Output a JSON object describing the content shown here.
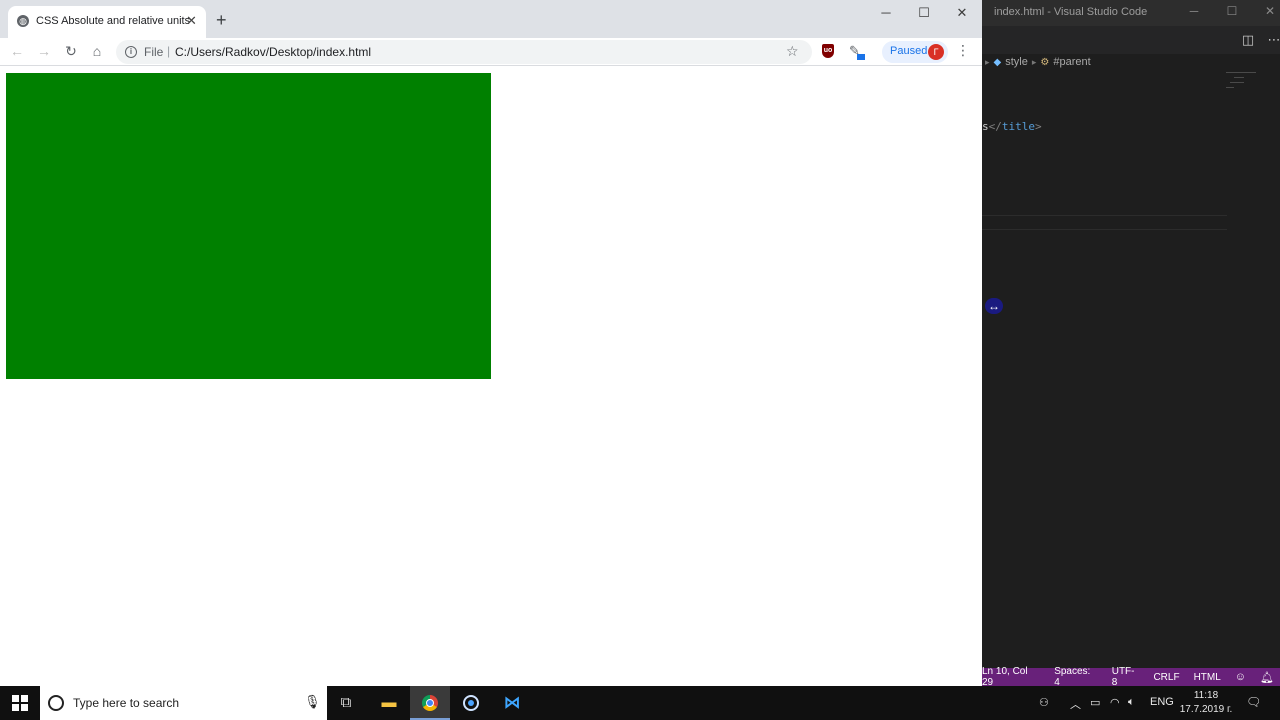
{
  "chrome": {
    "tab": {
      "title": "CSS Absolute and relative units",
      "favicon": "globe-icon"
    },
    "window_controls": {
      "minimize": "─",
      "maximize": "☐",
      "close": "✕"
    },
    "toolbar": {
      "back": "←",
      "forward": "→",
      "reload": "↻",
      "home": "⌂",
      "scheme": "File",
      "scheme_sep": "|",
      "url": "C:/Users/Radkov/Desktop/index.html",
      "star": "☆",
      "paused_label": "Paused",
      "avatar_letter": "Г",
      "menu": "⋮"
    },
    "page": {
      "box_color": "#008000"
    }
  },
  "vscode": {
    "title": "index.html - Visual Studio Code",
    "window_controls": {
      "minimize": "─",
      "maximize": "☐",
      "close": "✕"
    },
    "breadcrumbs": [
      "style",
      "#parent"
    ],
    "code_fragment": {
      "text": "s",
      "tag_open": "</",
      "tag_name": "title",
      "tag_close": ">"
    },
    "statusbar": {
      "position": "Ln 10, Col 29",
      "spaces": "Spaces: 4",
      "encoding": "UTF-8",
      "eol": "CRLF",
      "language": "HTML"
    },
    "accent": "#68217a"
  },
  "taskbar": {
    "search_placeholder": "Type here to search",
    "tray": {
      "language": "ENG"
    },
    "clock": {
      "time": "11:18",
      "date": "17.7.2019 г."
    }
  }
}
